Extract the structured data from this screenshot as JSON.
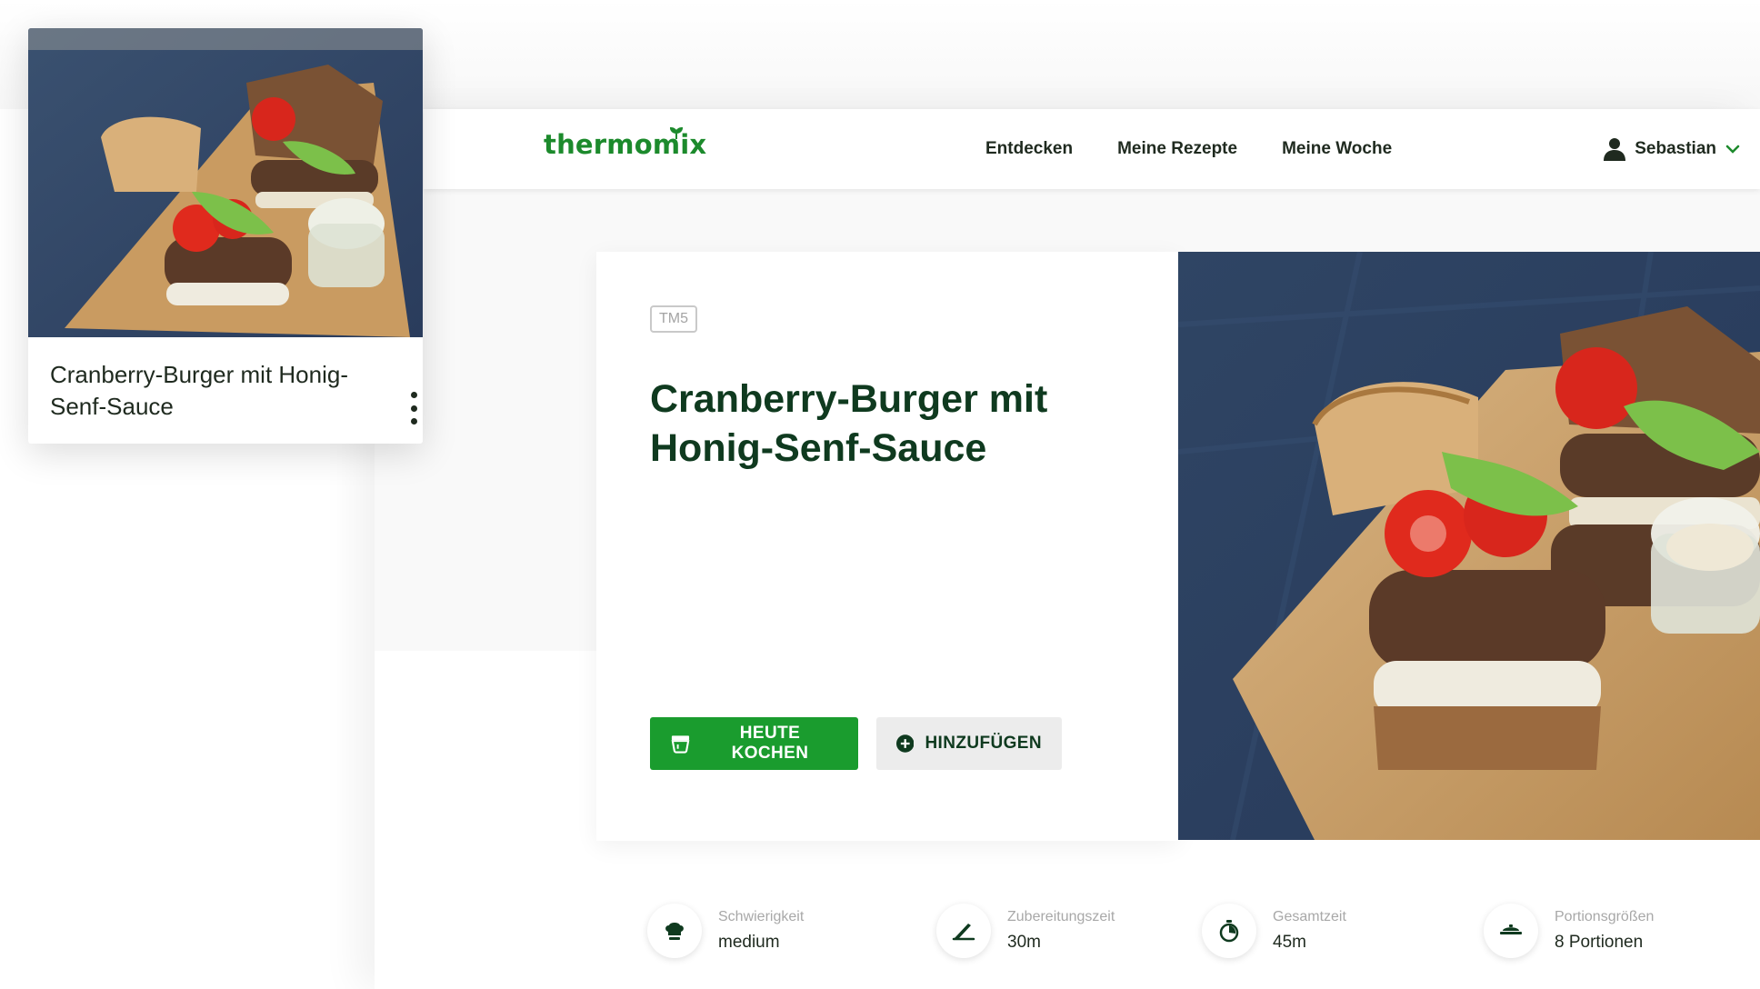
{
  "brand": {
    "logo": "thermomix",
    "color": "#1c8a2c"
  },
  "nav": {
    "links": [
      "Entdecken",
      "Meine Rezepte",
      "Meine Woche"
    ],
    "user": {
      "name": "Sebastian",
      "icon": "user-icon"
    }
  },
  "mini_card": {
    "title": "Cranberry-Burger mit Honig-Senf-Sauce",
    "menu_icon": "more-vertical-icon"
  },
  "hero": {
    "badge": "TM5",
    "title": "Cranberry-Burger mit Honig-Senf-Sauce",
    "primary_button": {
      "label": "HEUTE KOCHEN",
      "icon": "cooking-bowl-icon",
      "color": "#1a9c2e"
    },
    "secondary_button": {
      "label": "HINZUFÜGEN",
      "icon": "plus-circle-icon"
    }
  },
  "info": [
    {
      "label": "Schwierigkeit",
      "value": "medium",
      "icon": "chef-hat-icon"
    },
    {
      "label": "Zubereitungszeit",
      "value": "30m",
      "icon": "knife-icon"
    },
    {
      "label": "Gesamtzeit",
      "value": "45m",
      "icon": "timer-icon"
    },
    {
      "label": "Portionsgrößen",
      "value": "8 Portionen",
      "icon": "serving-dish-icon"
    }
  ]
}
